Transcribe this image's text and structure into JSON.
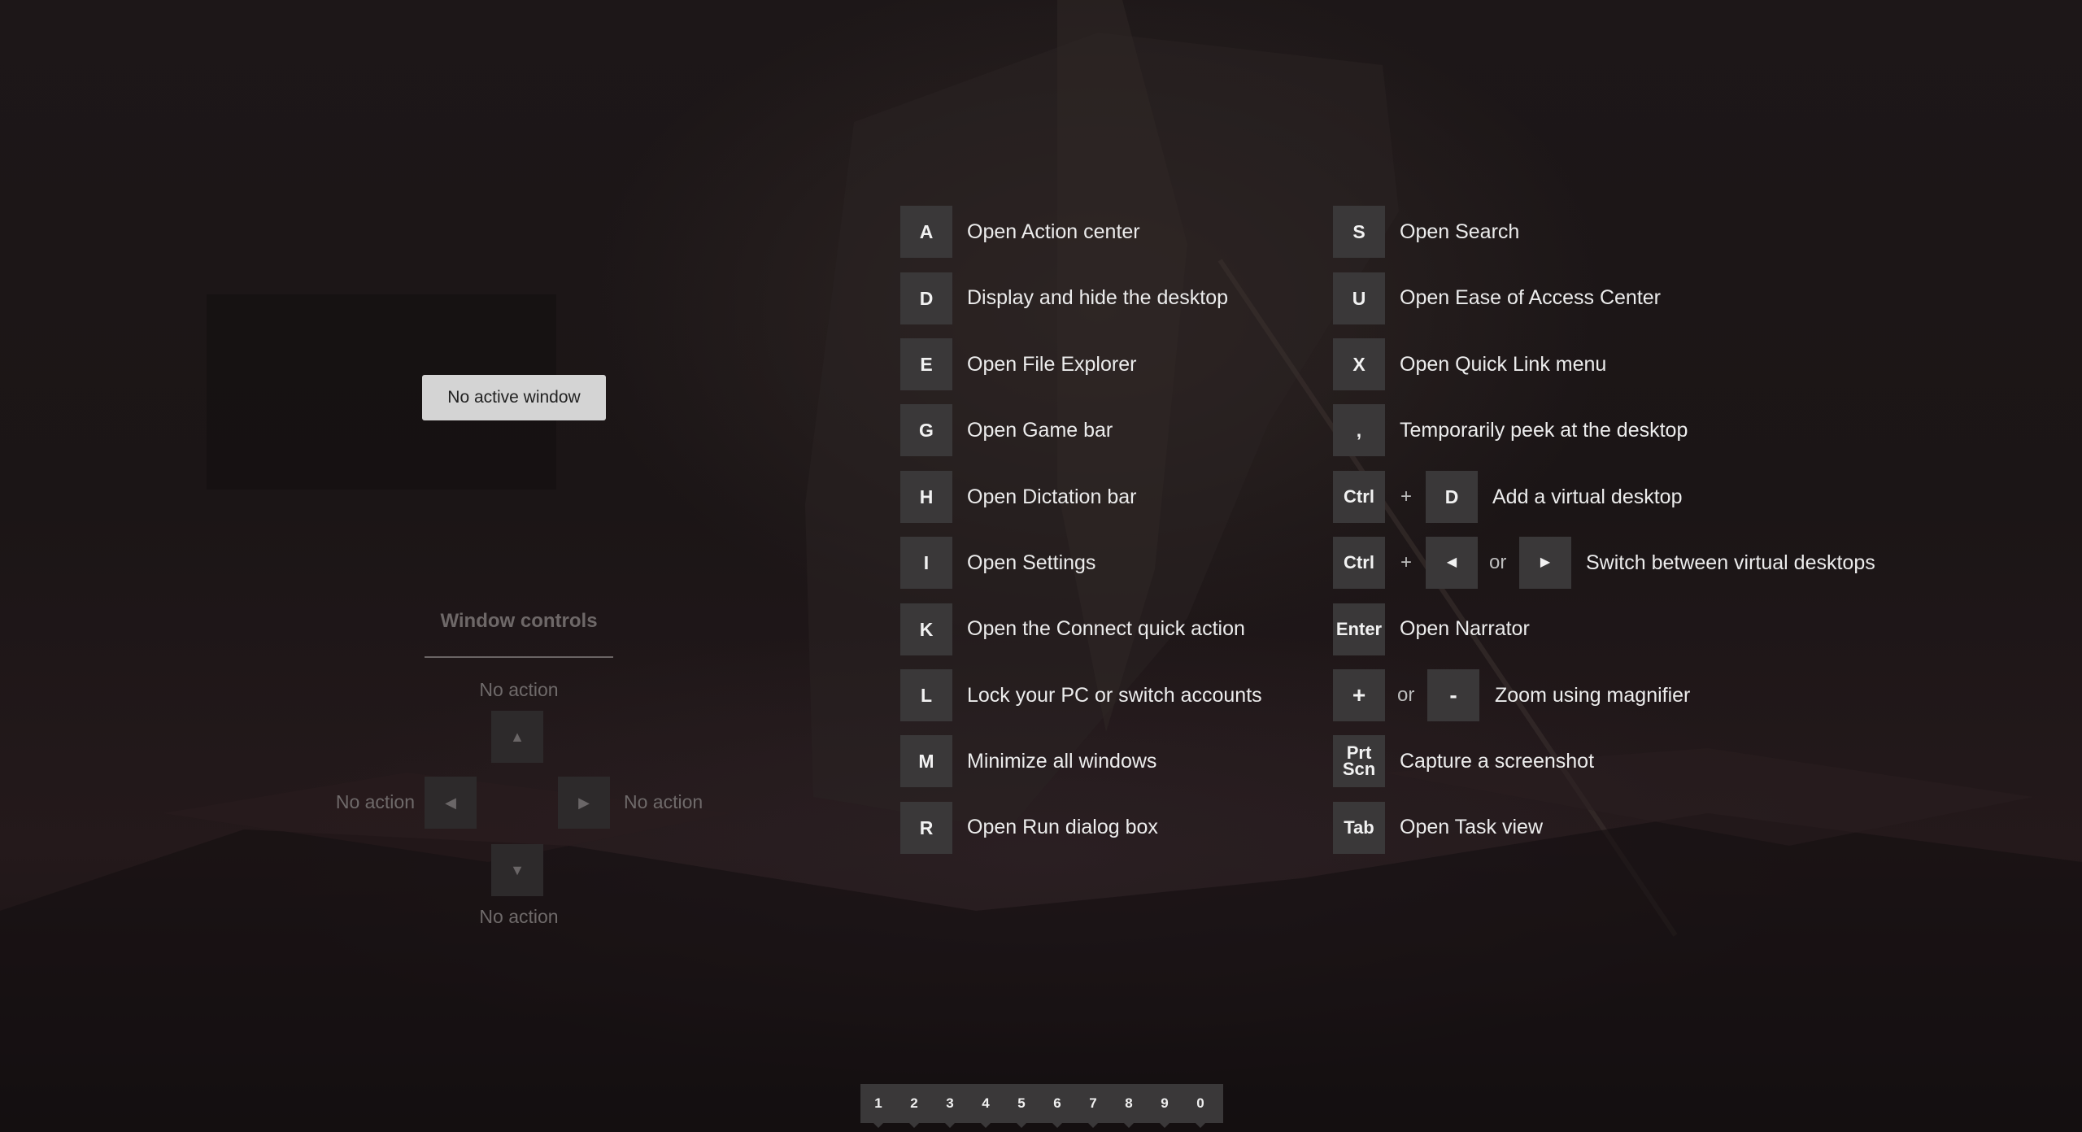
{
  "left_panel": {
    "active_window_label": "No active window",
    "window_controls_title": "Window controls",
    "up_action": "No action",
    "left_action": "No action",
    "right_action": "No action",
    "down_action": "No action"
  },
  "shortcuts_left": [
    {
      "key": "A",
      "label": "Open Action center"
    },
    {
      "key": "D",
      "label": "Display and hide the desktop"
    },
    {
      "key": "E",
      "label": "Open File Explorer"
    },
    {
      "key": "G",
      "label": "Open Game bar"
    },
    {
      "key": "H",
      "label": "Open Dictation bar"
    },
    {
      "key": "I",
      "label": "Open Settings"
    },
    {
      "key": "K",
      "label": "Open the Connect quick action"
    },
    {
      "key": "L",
      "label": "Lock your PC or switch accounts"
    },
    {
      "key": "M",
      "label": "Minimize all windows"
    },
    {
      "key": "R",
      "label": "Open Run dialog box"
    }
  ],
  "shortcuts_right": {
    "s": {
      "key": "S",
      "label": "Open Search"
    },
    "u": {
      "key": "U",
      "label": "Open Ease of Access Center"
    },
    "x": {
      "key": "X",
      "label": "Open Quick Link menu"
    },
    "comma": {
      "key": ",",
      "label": "Temporarily peek at the desktop"
    },
    "add_desktop": {
      "key1": "Ctrl",
      "op": "+",
      "key2": "D",
      "label": "Add a virtual desktop"
    },
    "switch_desktop": {
      "key1": "Ctrl",
      "op": "+",
      "or": "or",
      "label": "Switch between virtual desktops"
    },
    "narrator": {
      "key": "Enter",
      "label": "Open Narrator"
    },
    "magnifier": {
      "key1": "+",
      "or": "or",
      "key2": "-",
      "label": "Zoom using magnifier"
    },
    "screenshot": {
      "key_line1": "Prt",
      "key_line2": "Scn",
      "label": "Capture a screenshot"
    },
    "task_view": {
      "key": "Tab",
      "label": "Open Task view"
    }
  },
  "number_bar": [
    "1",
    "2",
    "3",
    "4",
    "5",
    "6",
    "7",
    "8",
    "9",
    "0"
  ],
  "colors": {
    "key_bg": "#3a3839",
    "active_window_bg": "#d4d4d4"
  }
}
